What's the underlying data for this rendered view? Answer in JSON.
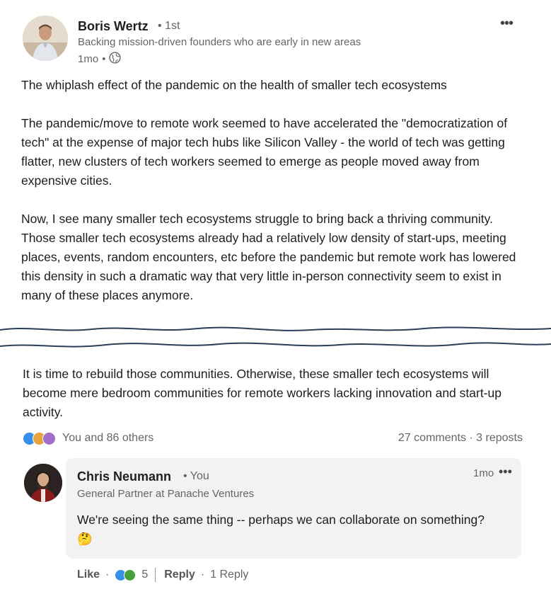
{
  "post": {
    "author": "Boris Wertz",
    "degree": "• 1st",
    "headline": "Backing mission-driven founders who are early in new areas",
    "time": "1mo",
    "time_sep": "•",
    "title_line": "The whiplash effect of the pandemic on the health of smaller tech ecosystems",
    "paragraph_1": "The pandemic/move to remote work seemed to have accelerated the \"democratization of tech\" at the expense of major tech hubs like Silicon Valley - the world of tech was getting flatter, new clusters of tech workers seemed to emerge as people moved away from expensive cities.",
    "paragraph_2": "Now, I see many smaller tech ecosystems struggle to bring back a thriving community. Those smaller tech ecosystems already had a relatively low density of start-ups, meeting places, events, random encounters, etc before the pandemic but remote work has lowered this density in such a dramatic way that very little in-person connectivity seem to exist in many of these places anymore.",
    "paragraph_3": "It is time to rebuild those communities. Otherwise, these smaller tech ecosystems will become mere bedroom communities for remote workers lacking innovation and start-up activity.",
    "more_icon": "•••"
  },
  "social": {
    "reactions_text": "You and 86 others",
    "counts": "27 comments · 3 reposts",
    "reaction_icons": [
      "like-icon",
      "celebrate-icon",
      "support-icon"
    ]
  },
  "comment": {
    "author": "Chris Neumann",
    "you": "• You",
    "headline": "General Partner at Panache Ventures",
    "time": "1mo",
    "more_icon": "•••",
    "text": "We're seeing the same thing -- perhaps we can collaborate on something? 🤔"
  },
  "comment_actions": {
    "like": "Like",
    "dot1": "·",
    "reaction_count": "5",
    "reply": "Reply",
    "dot2": "·",
    "replies": "1 Reply"
  },
  "colors": {
    "like_blue": "#378fe9",
    "celebrate_green": "#44a13c",
    "support_purple": "#a06fc9",
    "tear_line": "#2c3e57"
  }
}
